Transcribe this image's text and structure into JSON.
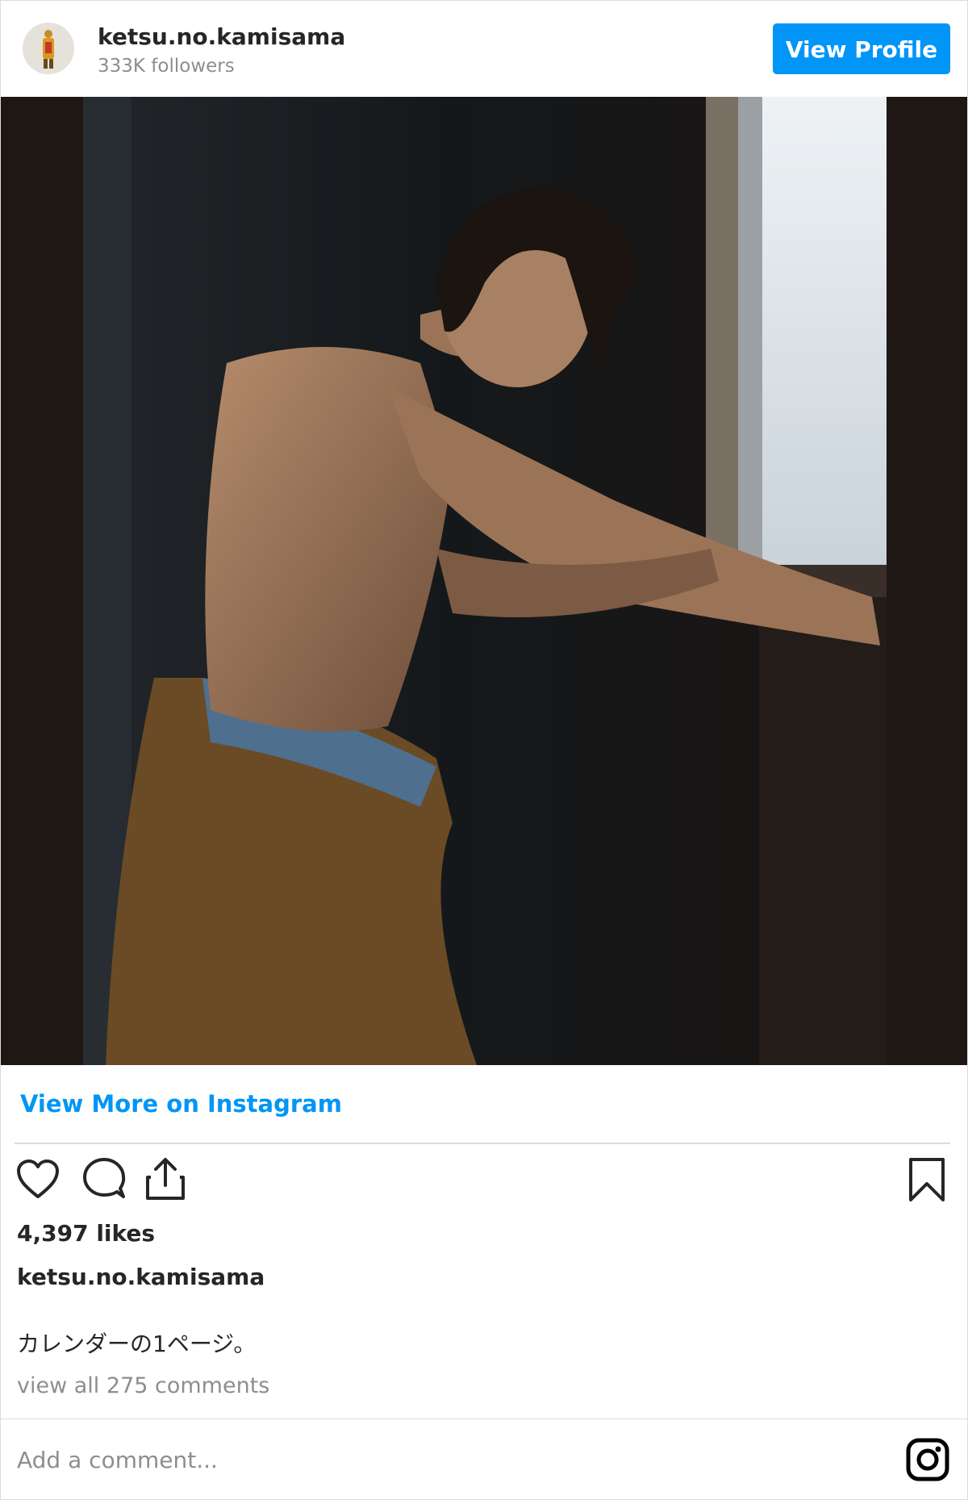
{
  "header": {
    "username": "ketsu.no.kamisama",
    "followers": "333K followers",
    "view_profile_label": "View Profile",
    "avatar_icon": "avatar-figure-icon"
  },
  "post": {
    "image_icon": "photo-image"
  },
  "footer": {
    "view_more_label": "View More on Instagram",
    "likes": "4,397 likes",
    "caption_user": "ketsu.no.kamisama",
    "caption_text": "カレンダーの1ページ。",
    "view_comments": "view all 275 comments",
    "comment_placeholder": "Add a comment...",
    "icons": [
      "heart-icon",
      "comment-icon",
      "share-icon",
      "bookmark-icon",
      "instagram-logo-icon"
    ]
  },
  "colors": {
    "accent": "#0095f6",
    "muted": "#8e8e8e",
    "text": "#262626",
    "divider": "#dbdbdb"
  }
}
